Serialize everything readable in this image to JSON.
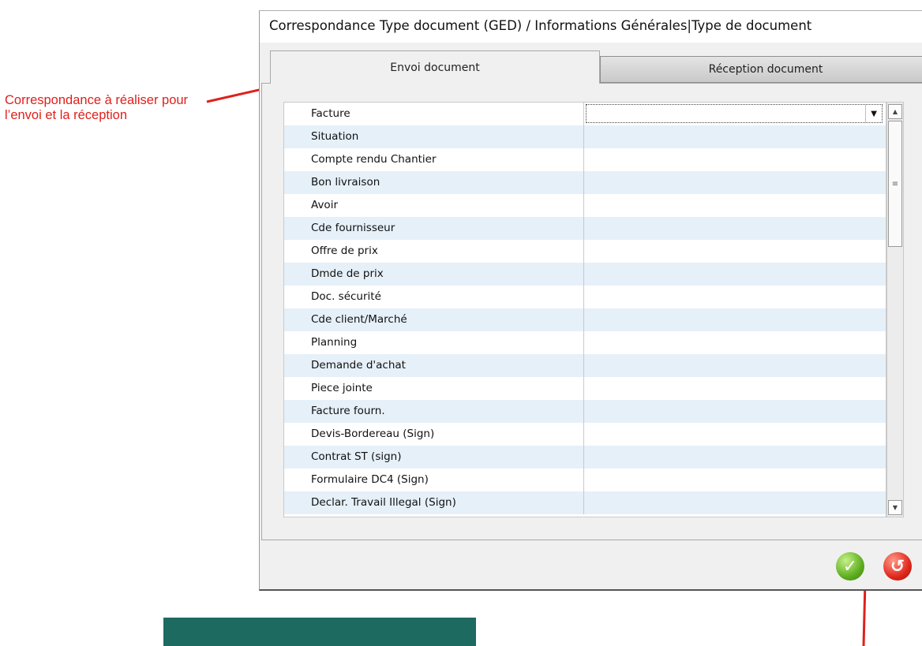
{
  "annotation": {
    "text": "Correspondance à réaliser pour l’envoi et la réception",
    "color": "#e0201c"
  },
  "window": {
    "title": "Correspondance Type document (GED) / Informations Générales|Type de document",
    "tabs": [
      {
        "label": "Envoi document",
        "active": true
      },
      {
        "label": "Réception document",
        "active": false
      }
    ],
    "rows": [
      {
        "label": "Facture",
        "value": ""
      },
      {
        "label": "Situation",
        "value": ""
      },
      {
        "label": "Compte rendu Chantier",
        "value": ""
      },
      {
        "label": "Bon livraison",
        "value": ""
      },
      {
        "label": "Avoir",
        "value": ""
      },
      {
        "label": "Cde fournisseur",
        "value": ""
      },
      {
        "label": "Offre de prix",
        "value": ""
      },
      {
        "label": "Dmde de prix",
        "value": ""
      },
      {
        "label": "Doc. sécurité",
        "value": ""
      },
      {
        "label": "Cde client/Marché",
        "value": ""
      },
      {
        "label": "Planning",
        "value": ""
      },
      {
        "label": "Demande d'achat",
        "value": ""
      },
      {
        "label": "Piece jointe",
        "value": ""
      },
      {
        "label": "Facture fourn.",
        "value": ""
      },
      {
        "label": "Devis-Bordereau (Sign)",
        "value": ""
      },
      {
        "label": "Contrat ST (sign)",
        "value": ""
      },
      {
        "label": "Formulaire DC4 (Sign)",
        "value": ""
      },
      {
        "label": "Declar. Travail Illegal (Sign)",
        "value": ""
      }
    ],
    "buttons": {
      "ok_icon": "check-icon",
      "cancel_icon": "undo-icon"
    }
  }
}
